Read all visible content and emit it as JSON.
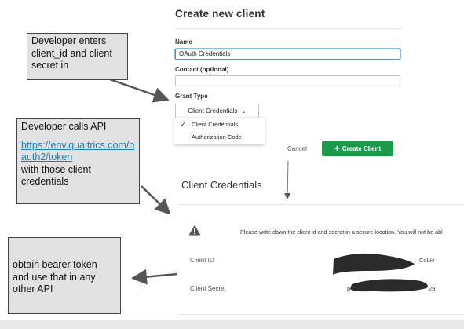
{
  "form": {
    "title": "Create new client",
    "name_label": "Name",
    "name_value": "OAuth Credentials",
    "contact_label": "Contact (optional)",
    "contact_value": "",
    "grant_label": "Grant Type",
    "grant_selected": "Client Credentials",
    "grant_options": [
      {
        "label": "Client Credentials",
        "checked": true
      },
      {
        "label": "Authorization Code",
        "checked": false
      }
    ],
    "cancel_label": "Cancel",
    "create_label": "Create Client"
  },
  "credentials": {
    "title": "Client Credentials",
    "warning": "Please write down the client id and secret in a secure location. You will not be abl",
    "client_id_label": "Client ID",
    "client_id_visible_tail": "CoLH",
    "client_secret_label": "Client Secret",
    "client_secret_visible_head": "p",
    "client_secret_visible_tail": "29"
  },
  "annotations": {
    "note1": "Developer enters client_id and client secret in",
    "note2_text": "Developer calls API",
    "note2_link": "https://env.qualtrics.com/oauth2/token",
    "note2_after": "with those client credentials",
    "note3": "obtain bearer token and use that in any other API"
  },
  "colors": {
    "create_button": "#1a9a4a",
    "link": "#1a7fb8",
    "note_fill": "#e2e2e2",
    "arrow": "#555555",
    "redaction": "#2a2a2a"
  },
  "icons": [
    "check-icon",
    "chevron-down-icon",
    "plus-icon",
    "warning-icon"
  ]
}
